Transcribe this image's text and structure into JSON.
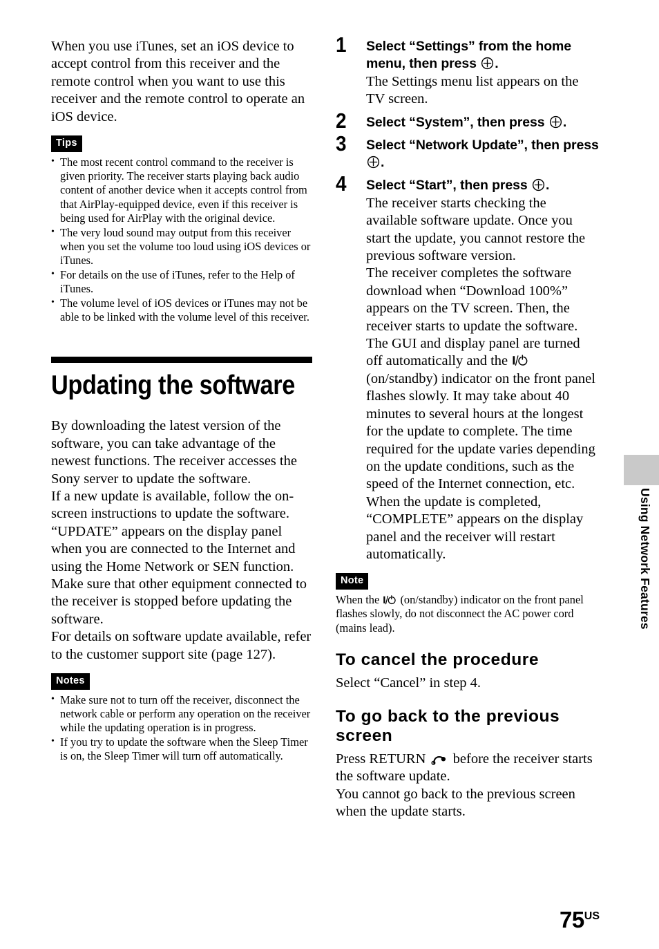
{
  "page": {
    "number": "75",
    "region_suffix": "US"
  },
  "side_tab": {
    "label": "Using Network Features",
    "block_color": "#c9c9c9"
  },
  "left_column": {
    "intro_paragraph": "When you use iTunes, set an iOS device to accept control from this receiver and the remote control when you want to use this receiver and the remote control to operate an iOS device.",
    "tips_badge": "Tips",
    "tips": [
      "The most recent control command to the receiver is given priority. The receiver starts playing back audio content of another device when it accepts control from that AirPlay-equipped device, even if this receiver is being used for AirPlay with the original device.",
      "The very loud sound may output from this receiver when you set the volume too loud using iOS devices or iTunes.",
      "For details on the use of iTunes, refer to the Help of iTunes.",
      "The volume level of iOS devices or iTunes may not be able to be linked with the volume level of this receiver."
    ],
    "section_heading": "Updating the software",
    "paragraphs": [
      "By downloading the latest version of the software, you can take advantage of the newest functions. The receiver accesses the Sony server to update the software.",
      "If a new update is available, follow the on-screen instructions to update the software. “UPDATE” appears on the display panel when you are connected to the Internet and using the Home Network or SEN function. Make sure that other equipment connected to the receiver is stopped before updating the software.",
      "For details on software update available, refer to the customer support site (page 127)."
    ],
    "notes_badge": "Notes",
    "notes": [
      "Make sure not to turn off the receiver, disconnect the network cable or perform any operation on the receiver while the updating operation is in progress.",
      "If you try to update the software when the Sleep Timer is on, the Sleep Timer will turn off automatically."
    ]
  },
  "right_column": {
    "steps": [
      {
        "number": "1",
        "title_part1": "Select “Settings” from the home menu, then press ",
        "title_part2": ".",
        "body": "The Settings menu list appears on the TV screen."
      },
      {
        "number": "2",
        "title_part1": "Select “System”, then press ",
        "title_part2": ".",
        "body": ""
      },
      {
        "number": "3",
        "title_part1": "Select “Network Update”, then press ",
        "title_part2": ".",
        "body": ""
      },
      {
        "number": "4",
        "title_part1": "Select “Start”, then press ",
        "title_part2": ".",
        "body": ""
      }
    ],
    "step4_body": {
      "para1": "The receiver starts checking the available software update. Once you start the update, you cannot restore the previous software version.",
      "para2a": "The receiver completes the software download when “Download 100%” appears on the TV screen. Then, the receiver starts to update the software. The GUI and display panel are turned off automatically and the ",
      "para2b": " (on/standby) indicator on the front panel flashes slowly. It may take about 40 minutes to several hours at the longest for the update to complete. The time required for the update varies depending on the update conditions, such as the speed of the Internet connection, etc.",
      "para3": "When the update is completed, “COMPLETE” appears on the display panel and the receiver will restart automatically."
    },
    "note_badge": "Note",
    "note_text_a": "When the ",
    "note_text_b": " (on/standby)  indicator on the front panel flashes slowly, do not disconnect the AC power cord (mains lead).",
    "cancel_heading": "To cancel the procedure",
    "cancel_text": "Select “Cancel” in step 4.",
    "back_heading": "To go back to the previous screen",
    "back_text_a": "Press RETURN ",
    "back_text_b": " before the receiver starts the software update.",
    "back_text_c": "You cannot go back to the previous screen when the update starts."
  },
  "icons": {
    "enter": "enter-circle-plus-icon",
    "power": "on-standby-power-icon",
    "return": "return-arrow-icon"
  }
}
